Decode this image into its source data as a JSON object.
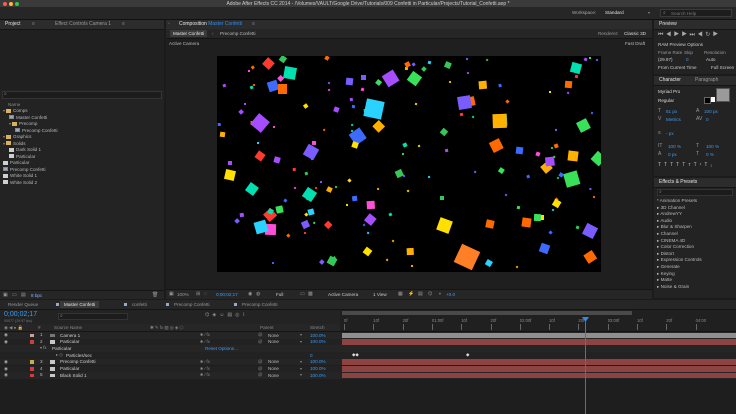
{
  "window": {
    "title": "Adobe After Effects CC 2014 - /Volumes/VAULT/Google Drive/Tutorials/009 Confetti in Particular/Projects/Tutorial_Confetti.aep *"
  },
  "workspace": {
    "label": "Workspace:",
    "value": "Standard",
    "search_placeholder": "Search Help"
  },
  "project": {
    "tab_label": "Project",
    "effect_controls_label": "Effect Controls Camera 1",
    "search_placeholder": "",
    "name_header": "Name",
    "tree": [
      {
        "label": "Comps",
        "kind": "folder",
        "indent": 0
      },
      {
        "label": "Master Confetti",
        "kind": "comp",
        "indent": 1
      },
      {
        "label": "Precomp",
        "kind": "folder",
        "indent": 1
      },
      {
        "label": "Precomp Confetti",
        "kind": "comp",
        "indent": 2
      },
      {
        "label": "Graphics",
        "kind": "folder",
        "indent": 0
      },
      {
        "label": "Solids",
        "kind": "folder",
        "indent": 0
      },
      {
        "label": "Dark Solid 1",
        "kind": "solid",
        "indent": 1
      },
      {
        "label": "Particular",
        "kind": "solid",
        "indent": 1
      },
      {
        "label": "Particular",
        "kind": "solid",
        "indent": 0
      },
      {
        "label": "Precomp Confetti",
        "kind": "comp",
        "indent": 0
      },
      {
        "label": "White Solid 1",
        "kind": "solid",
        "indent": 0
      },
      {
        "label": "White Solid 2",
        "kind": "solid",
        "indent": 0
      }
    ],
    "bpc": "8 bpc"
  },
  "composition": {
    "tab_label": "Composition",
    "tab_name": "Master Confetti",
    "subtab_active": "Master Confetti",
    "subtab_other": "Precomp Confetti",
    "renderer_label": "Renderer:",
    "renderer_value": "Classic 3D",
    "view_label": "Active Camera",
    "draft_label": "Fast Draft",
    "footer": {
      "zoom": "100%",
      "timecode": "0;00;02;17",
      "resolution": "Full",
      "camera": "Active Camera",
      "views": "1 View",
      "exposure": "+0.0"
    }
  },
  "preview": {
    "tab_label": "Preview",
    "ram_label": "RAM Preview Options",
    "frame_rate_label": "Frame Rate",
    "skip_label": "Skip",
    "resolution_label": "Resolution",
    "frame_rate_value": "(29.97)",
    "skip_value": "0",
    "resolution_value": "Auto",
    "from_current": "From Current Time",
    "full_screen": "Full Screen"
  },
  "character": {
    "tab_label": "Character",
    "paragraph_label": "Paragraph",
    "font": "Myriad Pro",
    "style": "Regular",
    "size": "51 px",
    "leading": "100 px",
    "tracking_label": "Metrics",
    "tracking_value": "0",
    "stroke_px": "- px",
    "vscale": "100 %",
    "hscale": "100 %",
    "baseline": "0 px",
    "tsume": "0 %"
  },
  "effects": {
    "tab_label": "Effects & Presets",
    "search_placeholder": "",
    "items": [
      "* Animation Presets",
      "3D Channel",
      "AndrewYY",
      "Audio",
      "Blur & Sharpen",
      "Channel",
      "CINEMA 4D",
      "Color Correction",
      "Distort",
      "Expression Controls",
      "Generate",
      "Keying",
      "Matte",
      "Noise & Grain"
    ]
  },
  "timeline": {
    "tabs": [
      "Render Queue",
      "Master Confetti",
      "confetti",
      "Precomp Confetti",
      "Precomp Confetti"
    ],
    "active_tab_index": 1,
    "timecode": "0;00;02;17",
    "frames": "00077 (29.97 fps)",
    "headers": {
      "num": "#",
      "source": "Source Name",
      "parent": "Parent",
      "stretch": "Stretch"
    },
    "ruler": [
      "0f",
      "10f",
      "20f",
      "01:00f",
      "10f",
      "20f",
      "02:00f",
      "10f",
      "20f",
      "03:00f",
      "10f",
      "20f",
      "04:00"
    ],
    "layers": [
      {
        "num": "1",
        "name": "Camera 1",
        "parent": "None",
        "stretch": "100.0%",
        "color": "#c9a0a0"
      },
      {
        "num": "2",
        "name": "Particular",
        "parent": "None",
        "stretch": "100.0%",
        "color": "#c94040"
      },
      {
        "num": "",
        "name": "Particular",
        "parent": "",
        "stretch": "",
        "color": "",
        "extra": "Reset  Options..."
      },
      {
        "num": "",
        "name": "Particles/sec",
        "parent": "",
        "stretch": "0",
        "color": ""
      },
      {
        "num": "3",
        "name": "Precomp Confetti",
        "parent": "None",
        "stretch": "100.0%",
        "color": "#c9a94a"
      },
      {
        "num": "4",
        "name": "Particular",
        "parent": "None",
        "stretch": "100.0%",
        "color": "#c94040"
      },
      {
        "num": "5",
        "name": "Black Solid 1",
        "parent": "None",
        "stretch": "100.0%",
        "color": "#c94040"
      }
    ]
  },
  "colors": {
    "accent": "#2d8ceb",
    "layer_bar": "#8e4343",
    "camera_bar": "#8f8f8f",
    "playhead": "#2d8ceb"
  }
}
